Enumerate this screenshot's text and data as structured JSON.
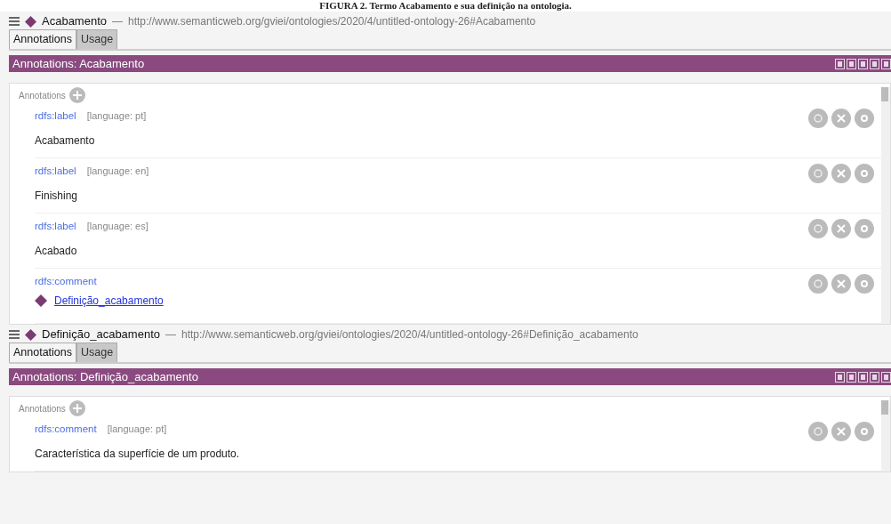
{
  "caption": "FIGURA 2. Termo Acabamento e sua definição na ontologia.",
  "frames": [
    {
      "entity": "Acabamento",
      "separator": "—",
      "iri": "http://www.semanticweb.org/gviei/ontologies/2020/4/untitled-ontology-26#Acabamento",
      "tabs": [
        {
          "label": "Annotations",
          "selected": true
        },
        {
          "label": "Usage",
          "selected": false
        }
      ],
      "panel_title": "Annotations: Acabamento",
      "annotations_label": "Annotations",
      "annotations": [
        {
          "kind": "literal",
          "property": "rdfs:label",
          "language": "[language: pt]",
          "value": "Acabamento"
        },
        {
          "kind": "literal",
          "property": "rdfs:label",
          "language": "[language: en]",
          "value": "Finishing"
        },
        {
          "kind": "literal",
          "property": "rdfs:label",
          "language": "[language: es]",
          "value": "Acabado"
        },
        {
          "kind": "entity",
          "property": "rdfs:comment",
          "value": "Definição_acabamento"
        }
      ]
    },
    {
      "entity": "Definição_acabamento",
      "separator": "—",
      "iri": "http://www.semanticweb.org/gviei/ontologies/2020/4/untitled-ontology-26#Definição_acabamento",
      "tabs": [
        {
          "label": "Annotations",
          "selected": true
        },
        {
          "label": "Usage",
          "selected": false
        }
      ],
      "panel_title": "Annotations: Definição_acabamento",
      "annotations_label": "Annotations",
      "annotations": [
        {
          "kind": "literal",
          "property": "rdfs:comment",
          "language": "[language: pt]",
          "value": "Característica da superfície de um produto."
        }
      ]
    }
  ]
}
